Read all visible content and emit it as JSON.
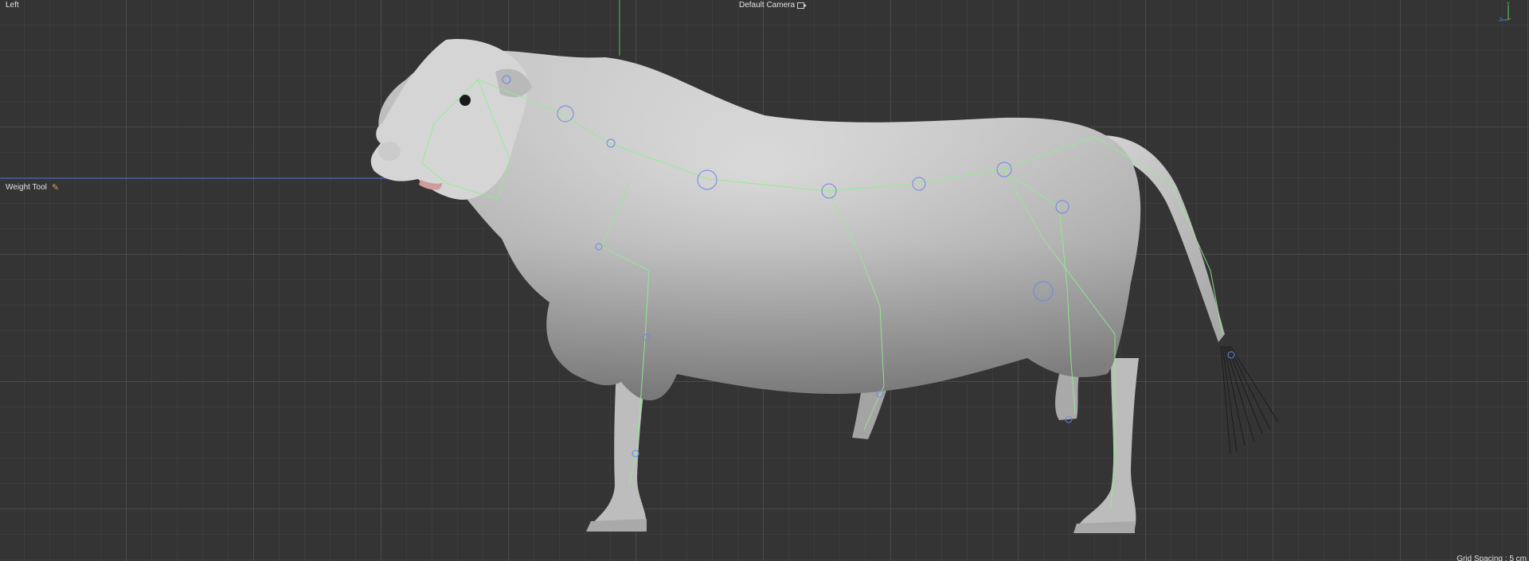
{
  "viewport": {
    "view_name": "Left",
    "camera": "Default Camera",
    "active_tool": "Weight Tool",
    "grid_spacing": "Grid Spacing : 5 cm",
    "icons": {
      "camera": "camera-link-icon",
      "tool": "weight-brush-icon",
      "gizmo": "axis-gizmo-icon"
    },
    "colors": {
      "background": "#343434",
      "axis_y": "#49c55a",
      "axis_z": "#4a73d8",
      "axis_x": "#d84a3a",
      "skeleton": "#8ef08a",
      "joint": "#6f86e8",
      "model": "#c9c9c9"
    }
  }
}
